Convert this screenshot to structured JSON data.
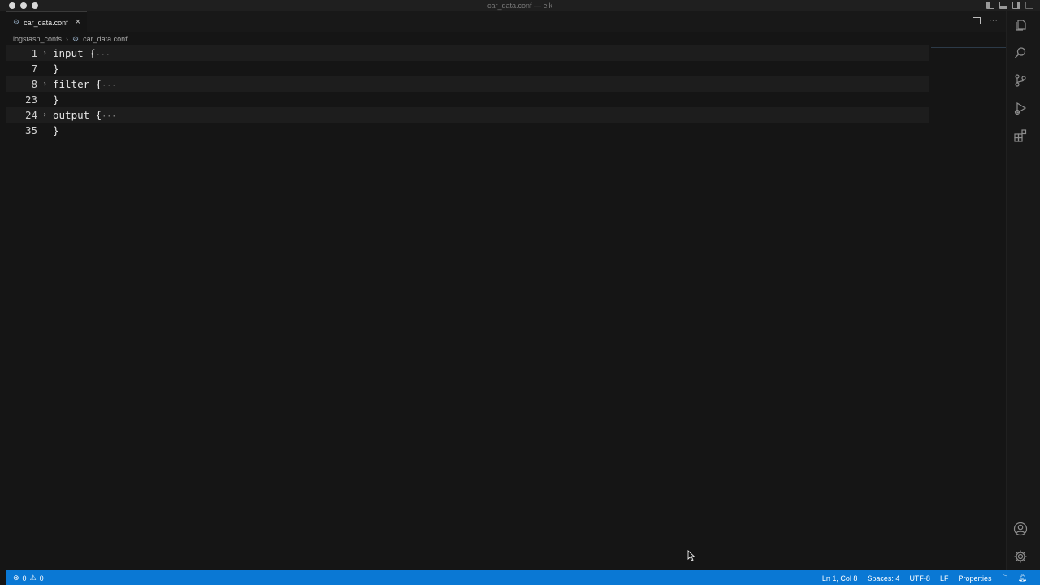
{
  "window": {
    "title": "car_data.conf — elk"
  },
  "tab": {
    "label": "car_data.conf",
    "icon": "gear-icon",
    "close": "×"
  },
  "breadcrumb": {
    "folder": "logstash_confs",
    "file": "car_data.conf"
  },
  "editor": {
    "lines": [
      {
        "num": "1",
        "code": "input {",
        "folded": true
      },
      {
        "num": "7",
        "code": "}",
        "folded": false
      },
      {
        "num": "8",
        "code": "filter {",
        "folded": true
      },
      {
        "num": "23",
        "code": "}",
        "folded": false
      },
      {
        "num": "24",
        "code": "output {",
        "folded": true
      },
      {
        "num": "35",
        "code": "}",
        "folded": false
      }
    ],
    "fold_ellipsis": "···"
  },
  "statusbar": {
    "errors": "0",
    "warnings": "0",
    "position": "Ln 1, Col 8",
    "spaces": "Spaces: 4",
    "encoding": "UTF-8",
    "eol": "LF",
    "language": "Properties"
  },
  "colors": {
    "statusbar_bg": "#0a78d4",
    "editor_bg": "#151515"
  }
}
